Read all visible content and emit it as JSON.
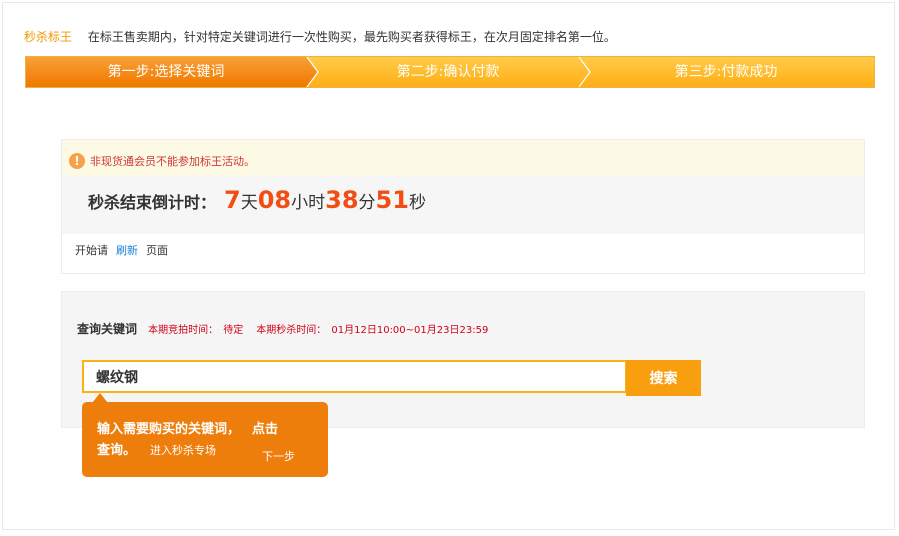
{
  "intro": {
    "brand": "秒杀标王",
    "description": "在标王售卖期内，针对特定关键词进行一次性购买，最先购买者获得标王，在次月固定排名第一位。"
  },
  "steps": [
    {
      "label": "第一步:选择关键词"
    },
    {
      "label": "第二步:确认付款"
    },
    {
      "label": "第三步:付款成功"
    }
  ],
  "notice": {
    "warning": "非现货通会员不能参加标王活动。",
    "countdown_label": "秒杀结束倒计时：",
    "days": "7",
    "days_unit": "天",
    "hours": "08",
    "hours_unit": "小时",
    "minutes": "38",
    "minutes_unit": "分",
    "seconds": "51",
    "seconds_unit": "秒",
    "refresh_prefix": "开始请",
    "refresh_link": "刷新",
    "refresh_suffix": "页面"
  },
  "search": {
    "title": "查询关键词",
    "bid_time_label": "本期竞拍时间：",
    "bid_time_value": "待定",
    "seckill_time_label": "本期秒杀时间：",
    "seckill_time_value": "01月12日10:00~01月23日23:59",
    "input_value": "螺纹钢",
    "button_label": "搜索"
  },
  "tooltip": {
    "line1": "输入需要购买的关键词，",
    "click": "点击",
    "line2": "查询。",
    "enter": "进入秒杀专场",
    "next": "下一步"
  },
  "colors": {
    "accent_orange": "#f89f0f",
    "countdown_red": "#f24e14",
    "link_blue": "#1a7fd8",
    "warning_red": "#d03838"
  },
  "icons": {
    "warning": "exclamation-circle-icon"
  }
}
